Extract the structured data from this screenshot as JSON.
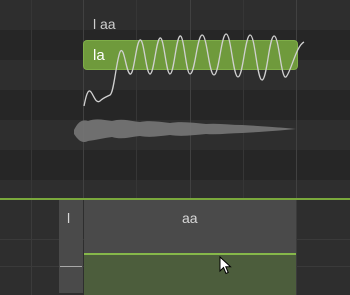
{
  "piano_roll": {
    "phoneme_hint": "l aa",
    "note": {
      "lyric": "la",
      "color": "#6f9a3c"
    }
  },
  "phoneme_track": {
    "phonemes": [
      {
        "label": "l"
      },
      {
        "label": "aa"
      }
    ],
    "accent_color": "#7aa83c"
  },
  "icons": {
    "cursor": "arrow-cursor-icon"
  }
}
